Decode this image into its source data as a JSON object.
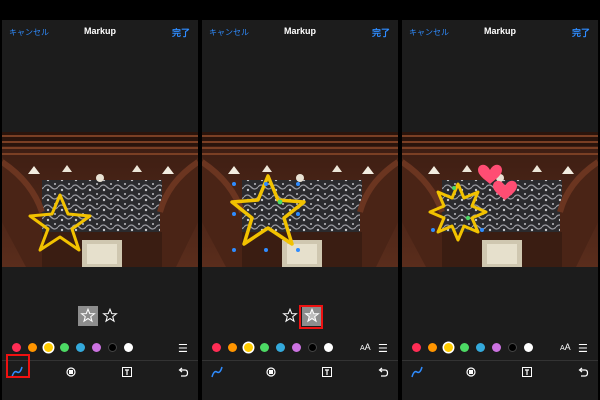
{
  "header": {
    "cancel_label": "キャンセル",
    "title": "Markup",
    "done_label": "完了"
  },
  "palette": {
    "colors": [
      "#ff2d55",
      "#ff9500",
      "#ffcc00",
      "#4cd964",
      "#34aadc",
      "#cc73e1",
      "#000000",
      "#ffffff"
    ],
    "selected": "#ffcc00"
  },
  "icons": {
    "star_outline": "star-outline-icon",
    "star_filled": "star-filled-icon",
    "menu": "menu-icon",
    "text_size": "text-size-icon",
    "pen": "pen-icon",
    "magnifier": "magnifier-icon",
    "text_box": "text-box-icon",
    "undo": "undo-icon"
  },
  "text_size_label": "A",
  "screens": [
    {
      "selected_shape": "star-outline",
      "highlight": "pen-tool"
    },
    {
      "selected_shape": "star-filled",
      "highlight": "star-filled"
    },
    {
      "selected_shape": "none",
      "highlight": "none"
    }
  ],
  "colors": {
    "accent": "#2f8cff",
    "highlight": "#ee1111",
    "star": "#f2c200",
    "heart": "#ff4d73"
  }
}
